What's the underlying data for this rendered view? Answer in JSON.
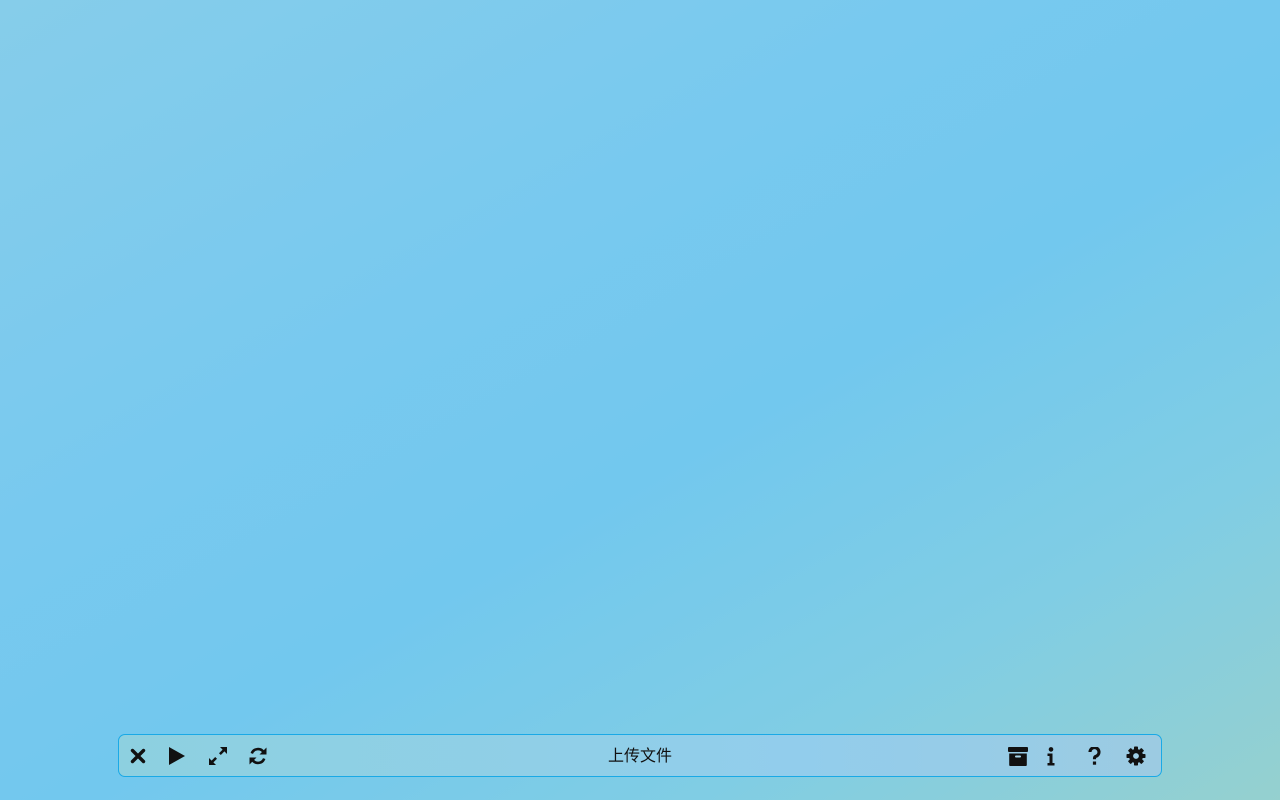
{
  "toolbar": {
    "title": "上传文件",
    "left_buttons": [
      {
        "name": "close-button",
        "icon": "close-icon"
      },
      {
        "name": "play-button",
        "icon": "play-icon"
      },
      {
        "name": "fullscreen-button",
        "icon": "expand-icon"
      },
      {
        "name": "refresh-button",
        "icon": "refresh-icon"
      }
    ],
    "right_buttons": [
      {
        "name": "archive-button",
        "icon": "archive-icon"
      },
      {
        "name": "info-button",
        "icon": "info-icon"
      },
      {
        "name": "help-button",
        "icon": "question-icon"
      },
      {
        "name": "settings-button",
        "icon": "gear-icon"
      }
    ],
    "border_color": "#1aa9e6",
    "icon_color": "#111111"
  }
}
